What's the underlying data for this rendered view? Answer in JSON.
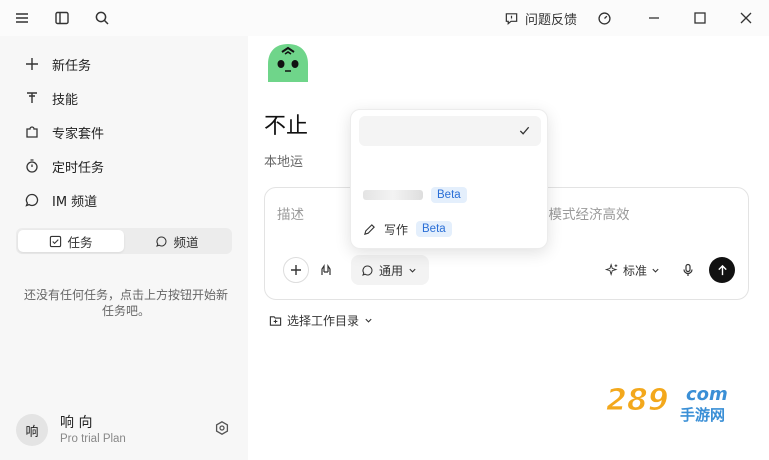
{
  "topbar": {
    "feedback_label": "问题反馈"
  },
  "sidebar": {
    "items": [
      {
        "label": "新任务",
        "icon": "plus-icon"
      },
      {
        "label": "技能",
        "icon": "skill-icon"
      },
      {
        "label": "专家套件",
        "icon": "puzzle-icon"
      },
      {
        "label": "定时任务",
        "icon": "timer-icon"
      },
      {
        "label": "IM 频道",
        "icon": "chat-icon"
      }
    ],
    "tabs": [
      {
        "label": "任务",
        "icon": "checkbox-icon",
        "active": true
      },
      {
        "label": "频道",
        "icon": "chat-icon",
        "active": false
      }
    ],
    "empty_message": "还没有任何任务，点击上方按钮开始新任务吧。"
  },
  "user": {
    "avatar_text": "响",
    "name": "响 向",
    "plan": "Pro trial Plan"
  },
  "main": {
    "headline": "不止",
    "subtitle": "本地运",
    "composer": {
      "placeholder_left": "描述",
      "placeholder_right": "捷模式经济高效",
      "mode_label": "通用",
      "quality_label": "标准"
    },
    "workdir_label": "选择工作目录"
  },
  "dropdown": {
    "items": [
      {
        "label": "",
        "badge": "",
        "selected": true
      },
      {
        "label": "",
        "badge": "Beta",
        "selected": false
      },
      {
        "label": "写作",
        "badge": "Beta",
        "selected": false
      }
    ]
  },
  "watermark": {
    "brand": "289",
    "suffix": "com",
    "tagline": "手游网"
  },
  "colors": {
    "accent": "#111111",
    "logo_green": "#6fd58a",
    "badge_blue": "#2b6fd6",
    "sidebar_bg": "#f7f7f7"
  }
}
